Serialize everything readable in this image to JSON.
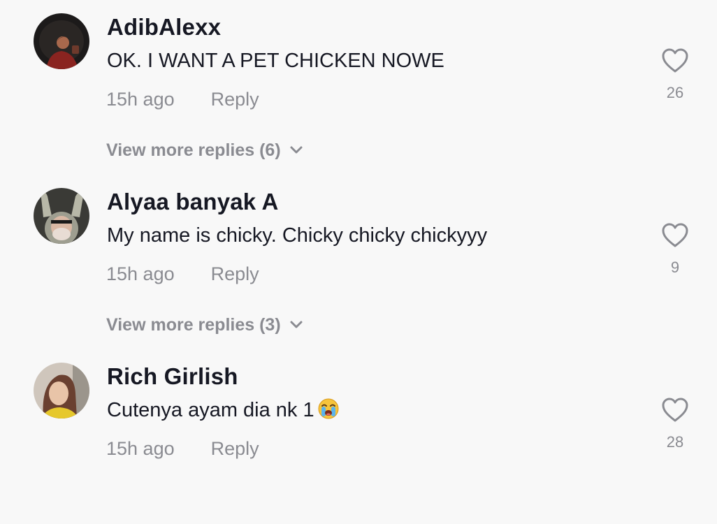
{
  "comments": [
    {
      "username": "AdibAlexx",
      "text": "OK. I WANT A PET CHICKEN NOWE",
      "time": "15h ago",
      "reply_label": "Reply",
      "likes": "26",
      "view_more_label": "View more replies (6)",
      "avatar_icon": "user-avatar-dark"
    },
    {
      "username": "Alyaa banyak A",
      "text": "My name is chicky. Chicky chicky chickyyy",
      "time": "15h ago",
      "reply_label": "Reply",
      "likes": "9",
      "view_more_label": "View more replies (3)",
      "avatar_icon": "user-avatar-bunny-ears"
    },
    {
      "username": "Rich Girlish",
      "text": "Cutenya ayam dia nk 1",
      "time": "15h ago",
      "reply_label": "Reply",
      "likes": "28",
      "emoji": "loudly-crying-face-emoji",
      "avatar_icon": "user-avatar-portrait"
    }
  ],
  "colors": {
    "background": "#f8f8f8",
    "primary_text": "#161823",
    "secondary_text": "#8a8b91"
  }
}
